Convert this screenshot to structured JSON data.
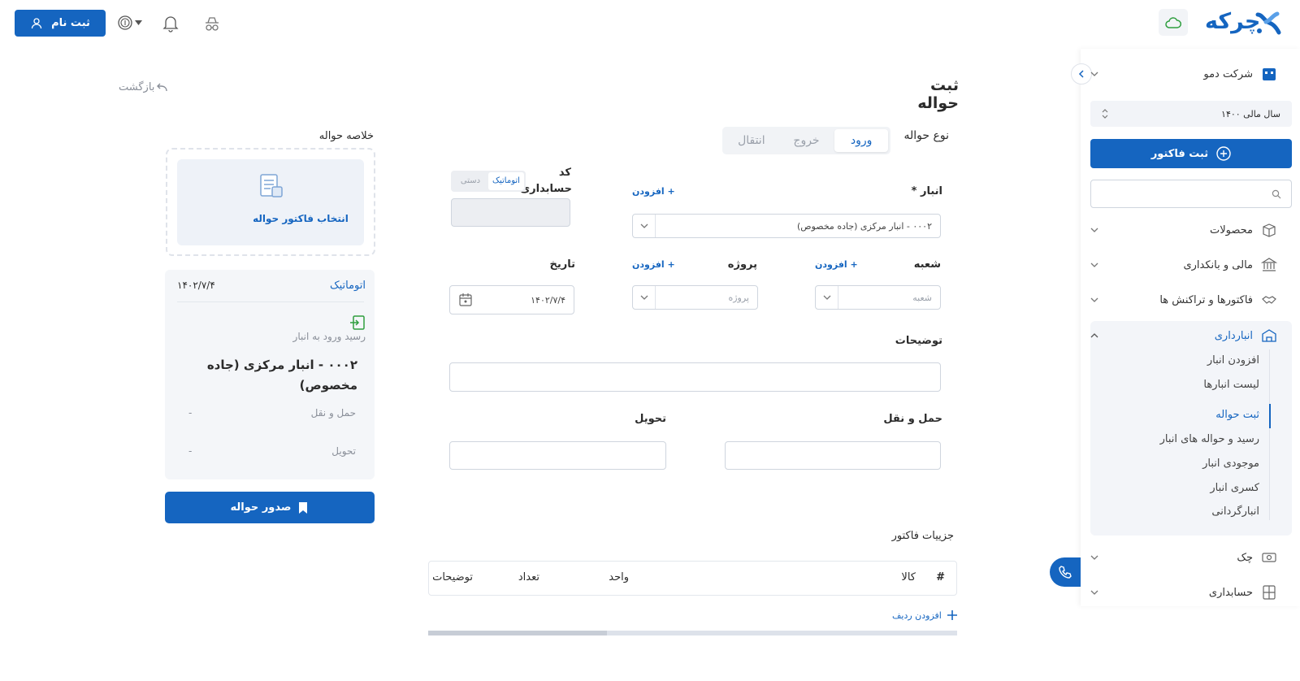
{
  "header": {
    "signup_label": "ثبت نام",
    "logo_text": "چرکه"
  },
  "sidebar": {
    "company": "شرکت دمو",
    "fiscal_year": "سال مالی ۱۴۰۰",
    "new_invoice_label": "ثبت فاکتور",
    "menu": {
      "products": "محصولات",
      "finance": "مالی و بانکداری",
      "invoices": "فاکتورها و تراکنش ها",
      "inventory": "انبارداری",
      "cheque": "چک",
      "accounting": "حسابداری"
    },
    "inventory_items": [
      "افزودن انبار",
      "لیست انبارها",
      "ثبت حواله",
      "رسید و حواله های انبار",
      "موجودی انبار",
      "کسری انبار",
      "انبارگردانی"
    ]
  },
  "main": {
    "title": "ثبت حواله",
    "back_label": "بازگشت",
    "type_label": "نوع حواله",
    "tabs": [
      "ورود",
      "خروج",
      "انتقال"
    ],
    "warehouse": {
      "label": "انبار *",
      "value": "۰۰۰۲ - انبار مرکزی (جاده مخصوص)",
      "add": "+ افزودن"
    },
    "accounting_code": {
      "label_line1": "کد",
      "label_line2": "حسابداری",
      "auto": "اتوماتیک",
      "manual": "دستی"
    },
    "branch": {
      "label": "شعبه",
      "placeholder": "شعبه",
      "add": "+ افزودن"
    },
    "project": {
      "label": "پروژه",
      "placeholder": "پروژه",
      "add": "+ افزودن"
    },
    "date": {
      "label": "تاریخ",
      "value": "۱۴۰۲/۷/۴"
    },
    "description_label": "توضیحات",
    "transport_label": "حمل و نقل",
    "delivery_label": "تحویل",
    "details_title": "جزییات فاکتور",
    "table_headers": {
      "index": "#",
      "item": "کالا",
      "unit": "واحد",
      "qty": "تعداد",
      "desc": "توضیحات"
    },
    "add_row": "افزودن ردیف"
  },
  "summary": {
    "title": "خلاصه حواله",
    "select_invoice": "انتخاب فاکتور حواله",
    "mode": "اتوماتیک",
    "date": "۱۴۰۲/۷/۴",
    "receipt_label": "رسید ورود به انبار",
    "warehouse_line1": "۰۰۰۲ - انبار مرکزی (جاده",
    "warehouse_line2": "مخصوص)",
    "transport_label": "حمل و نقل",
    "transport_value": "-",
    "delivery_label": "تحویل",
    "delivery_value": "-",
    "issue_button": "صدور حواله"
  },
  "colors": {
    "primary": "#1565c0",
    "panel": "#f4f6f9",
    "green": "#2e9e3e"
  }
}
